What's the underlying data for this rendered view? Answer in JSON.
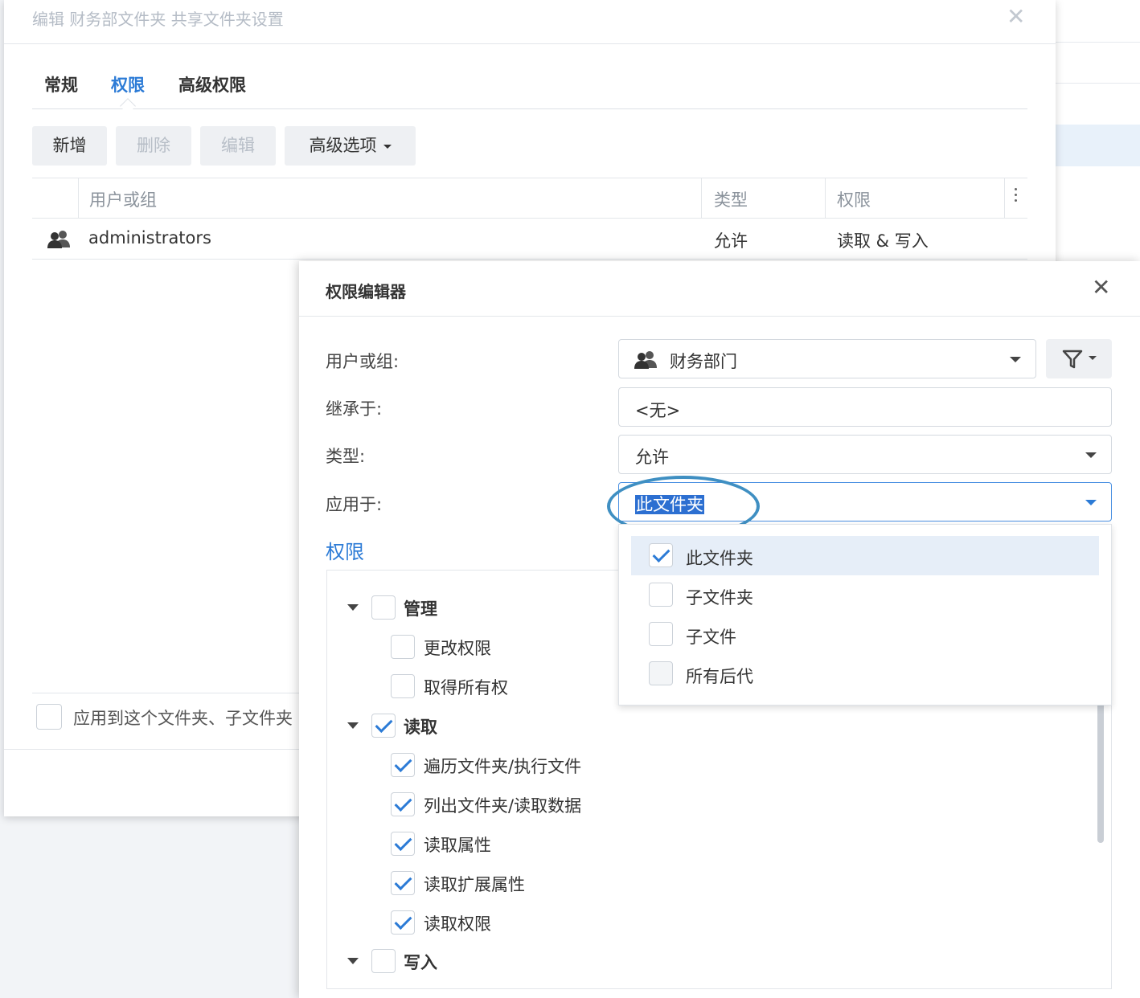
{
  "outer_dialog": {
    "title": "编辑 财务部文件夹 共享文件夹设置",
    "close_glyph": "✕",
    "tabs": [
      {
        "label": "常规",
        "active": false
      },
      {
        "label": "权限",
        "active": true
      },
      {
        "label": "高级权限",
        "active": false
      }
    ],
    "toolbar": {
      "add": "新增",
      "delete": "删除",
      "edit": "编辑",
      "advanced": "高级选项"
    },
    "grid": {
      "headers": {
        "user_or_group": "用户或组",
        "type": "类型",
        "permission": "权限"
      },
      "rows": [
        {
          "icon": "group-icon",
          "name": "administrators",
          "type": "允许",
          "permission": "读取 & 写入"
        }
      ]
    },
    "apply_checkbox_label": "应用到这个文件夹、子文件夹"
  },
  "permission_editor": {
    "title": "权限编辑器",
    "close_glyph": "✕",
    "fields": {
      "user_or_group_label": "用户或组:",
      "user_or_group_value": "财务部门",
      "inherit_label": "继承于:",
      "inherit_value": "<无>",
      "type_label": "类型:",
      "type_value": "允许",
      "apply_to_label": "应用于:",
      "apply_to_value": "此文件夹"
    },
    "permissions_heading": "权限",
    "tree": {
      "manage": {
        "label": "管理",
        "checked": false,
        "children": [
          {
            "label": "更改权限",
            "checked": false
          },
          {
            "label": "取得所有权",
            "checked": false
          }
        ]
      },
      "read": {
        "label": "读取",
        "checked": true,
        "children": [
          {
            "label": "遍历文件夹/执行文件",
            "checked": true
          },
          {
            "label": "列出文件夹/读取数据",
            "checked": true
          },
          {
            "label": "读取属性",
            "checked": true
          },
          {
            "label": "读取扩展属性",
            "checked": true
          },
          {
            "label": "读取权限",
            "checked": true
          }
        ]
      },
      "write": {
        "label": "写入",
        "checked": false
      }
    },
    "apply_to_menu": [
      {
        "label": "此文件夹",
        "checked": true,
        "highlighted": true
      },
      {
        "label": "子文件夹",
        "checked": false
      },
      {
        "label": "子文件",
        "checked": false
      },
      {
        "label": "所有后代",
        "checked": false,
        "disabled": true
      }
    ]
  },
  "colors": {
    "accent": "#2c7bd6",
    "annotation_ring": "#3f8fc2",
    "text_selection": "#2c6fd1",
    "menu_highlight": "#e6eef8"
  }
}
